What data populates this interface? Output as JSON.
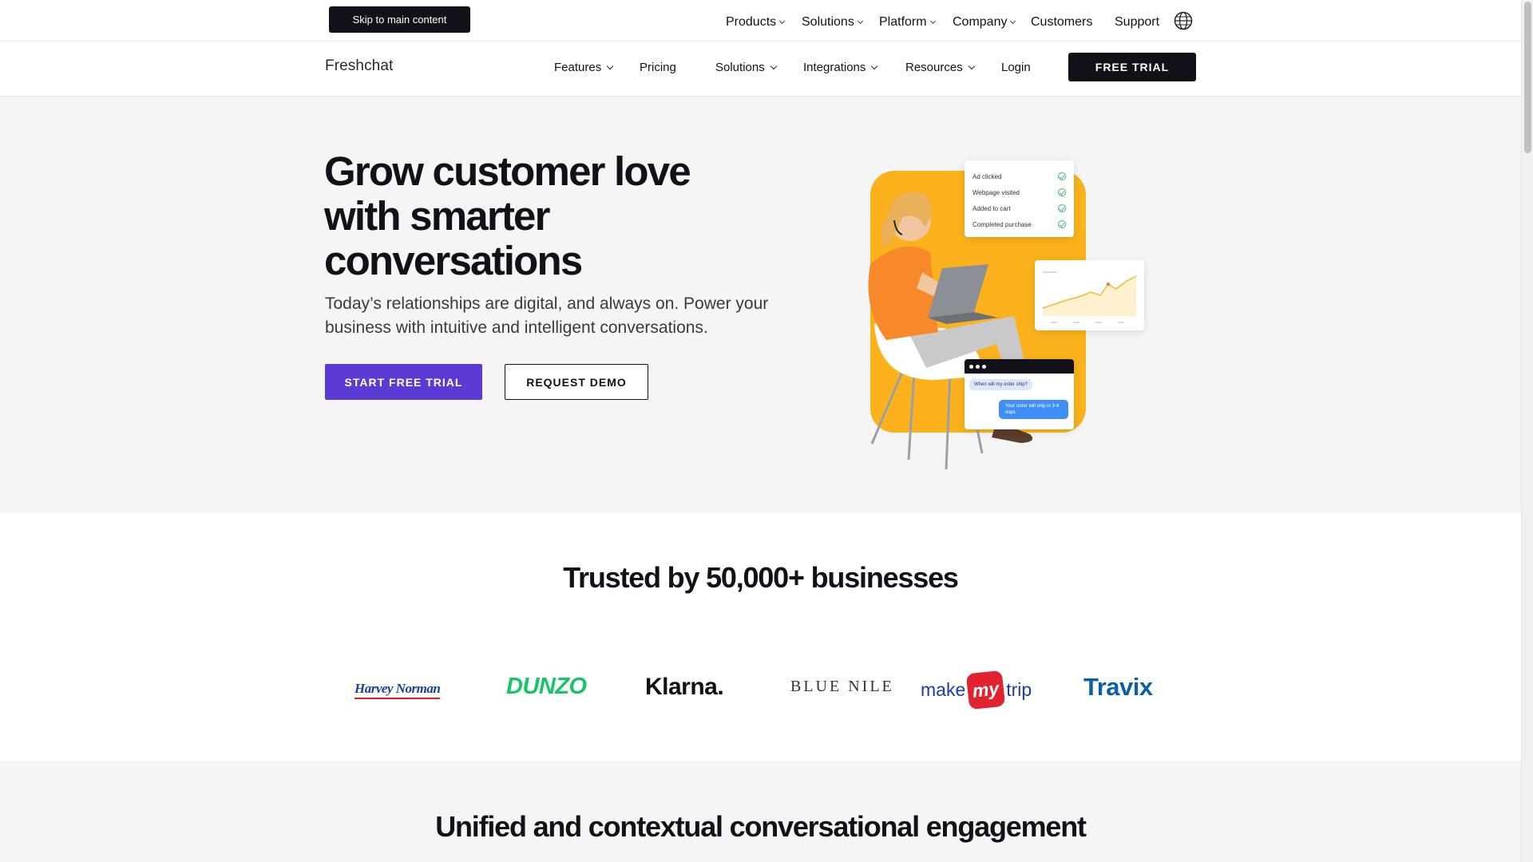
{
  "utility": {
    "skip_label": "Skip to main content",
    "items": [
      "Products",
      "Solutions",
      "Platform",
      "Company",
      "Customers",
      "Support"
    ]
  },
  "nav": {
    "logo": "Freshchat",
    "features": "Features",
    "pricing": "Pricing",
    "solutions": "Solutions",
    "integrations": "Integrations",
    "resources": "Resources",
    "login": "Login",
    "trial": "FREE TRIAL"
  },
  "hero": {
    "title": "Grow customer love with smarter conversations",
    "subtitle": "Today’s relationships are digital, and always on. Power your business with intuitive and intelligent conversations.",
    "primary_cta": "START FREE TRIAL",
    "secondary_cta": "REQUEST DEMO",
    "checklist": [
      "Ad clicked",
      "Webpage visited",
      "Added to cart",
      "Completed purchase"
    ],
    "chat_question": "When will my order ship?",
    "chat_answer": "Your order will ship in 3-4 days"
  },
  "trusted": {
    "title": "Trusted by 50,000+ businesses",
    "brands": {
      "harvey": "Harvey Norman",
      "dunzo": "DUNZO",
      "klarna": "Klarna.",
      "bluenile": "BLUE NILE",
      "mmt_make": "make",
      "mmt_my": "my",
      "mmt_trip": "trip",
      "travix": "Travix"
    }
  },
  "unified": {
    "title": "Unified and contextual conversational engagement"
  },
  "colors": {
    "primary": "#5b3bd3",
    "dark": "#12111a",
    "hero_bg": "#f5f5f5",
    "accent_yellow": "#fbb21c"
  }
}
